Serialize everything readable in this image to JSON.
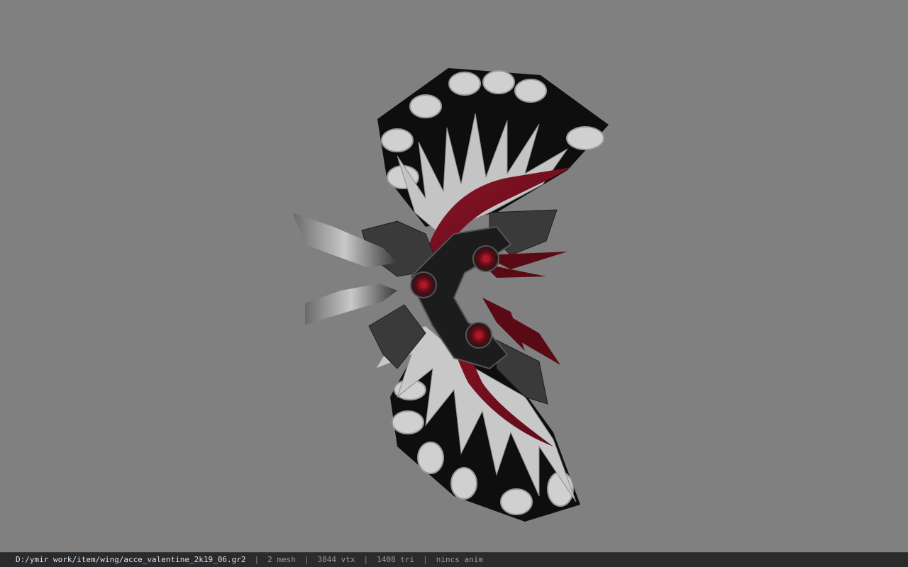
{
  "status_bar": {
    "file_path": "D:/ymir work/item/wing/acce_valentine_2k19_06.gr2",
    "separator": "|",
    "mesh_count": "2 mesh",
    "vertex_count": "3844 vtx",
    "triangle_count": "1408 tri",
    "animation": "nincs anim"
  },
  "colors": {
    "background": "#808080",
    "feather_red": "#7a1020",
    "feather_white": "#d8d8d8",
    "frame_dark": "#141414"
  }
}
